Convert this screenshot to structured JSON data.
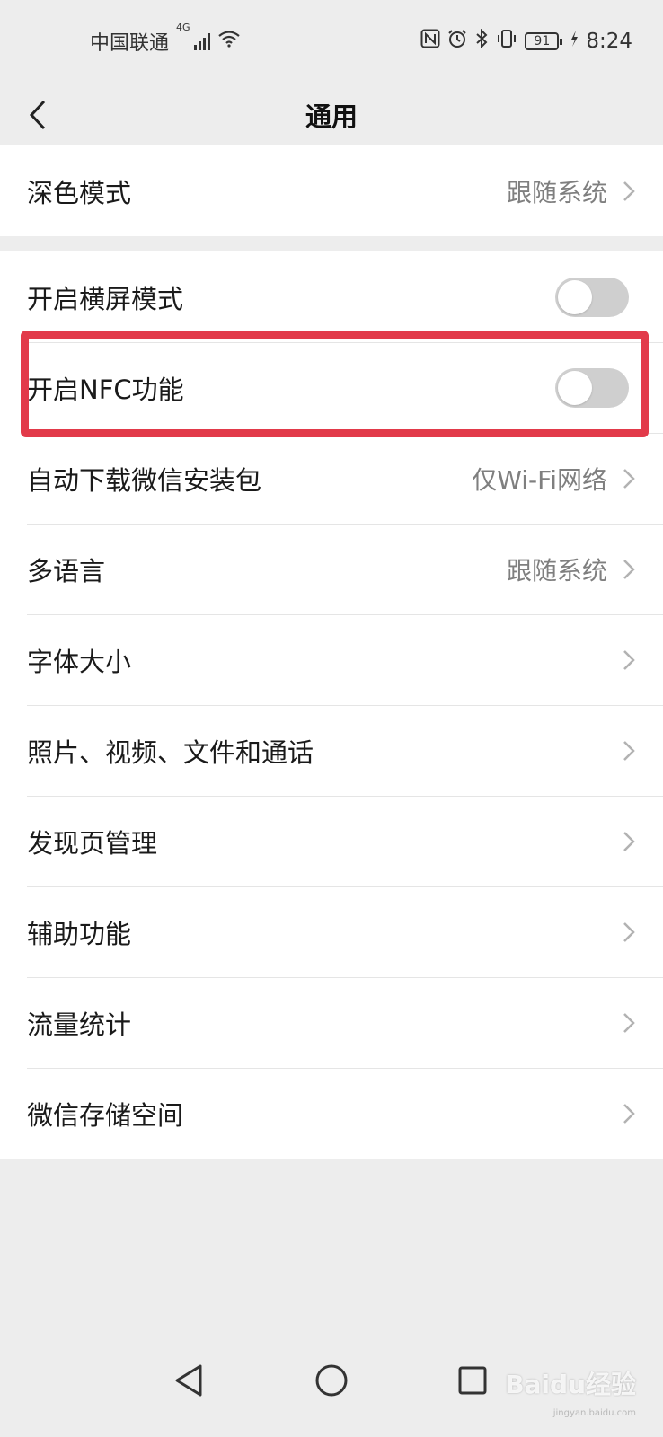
{
  "status_bar": {
    "carrier": "中国联通",
    "network": "4G",
    "battery": "91",
    "time": "8:24"
  },
  "header": {
    "title": "通用"
  },
  "groups": {
    "dark_mode": {
      "label": "深色模式",
      "value": "跟随系统"
    },
    "landscape": {
      "label": "开启横屏模式",
      "toggle_on": false
    },
    "nfc": {
      "label": "开启NFC功能",
      "toggle_on": false
    },
    "auto_download": {
      "label": "自动下载微信安装包",
      "value": "仅Wi-Fi网络"
    },
    "language": {
      "label": "多语言",
      "value": "跟随系统"
    },
    "font_size": {
      "label": "字体大小"
    },
    "media": {
      "label": "照片、视频、文件和通话"
    },
    "discover": {
      "label": "发现页管理"
    },
    "accessibility": {
      "label": "辅助功能"
    },
    "data_usage": {
      "label": "流量统计"
    },
    "storage": {
      "label": "微信存储空间"
    }
  },
  "watermark": {
    "brand": "Baidu经验",
    "url": "jingyan.baidu.com"
  },
  "colors": {
    "highlight": "#e23a4a",
    "toggle_off": "#cfcfcf",
    "background": "#ededed"
  }
}
